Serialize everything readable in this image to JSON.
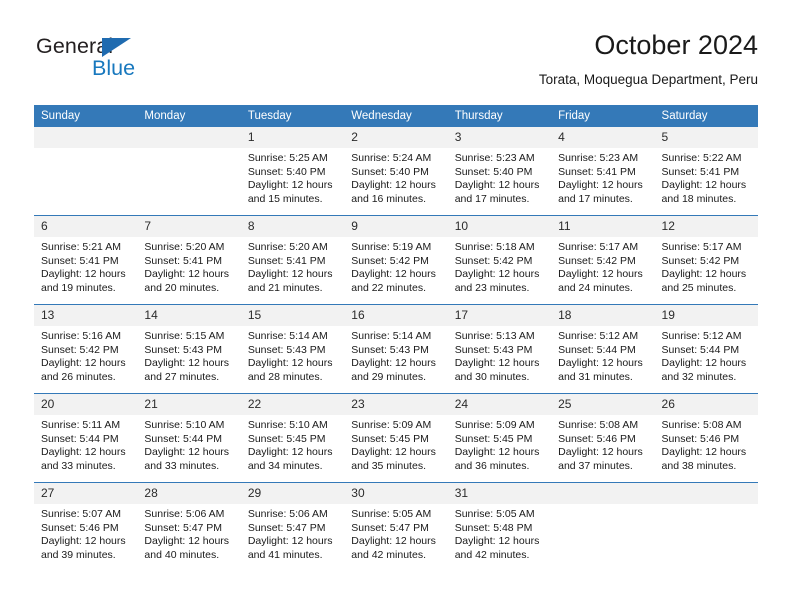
{
  "logo": {
    "word_top": "General",
    "word_bottom": "Blue",
    "triangle_color": "#1f6bb0",
    "blue_color": "#1878be"
  },
  "header": {
    "title": "October 2024",
    "subtitle": "Torata, Moquegua Department, Peru"
  },
  "theme": {
    "header_bg": "#3479b8",
    "header_text": "#ffffff",
    "daynum_bg": "#f2f2f2",
    "row_divider": "#3479b8"
  },
  "weekdays": [
    "Sunday",
    "Monday",
    "Tuesday",
    "Wednesday",
    "Thursday",
    "Friday",
    "Saturday"
  ],
  "labels": {
    "sunrise_prefix": "Sunrise:",
    "sunset_prefix": "Sunset:",
    "daylight_prefix": "Daylight:"
  },
  "weeks": [
    [
      {
        "day": "",
        "sunrise": "",
        "sunset": "",
        "daylight_1": "",
        "daylight_2": ""
      },
      {
        "day": "",
        "sunrise": "",
        "sunset": "",
        "daylight_1": "",
        "daylight_2": ""
      },
      {
        "day": "1",
        "sunrise": "Sunrise: 5:25 AM",
        "sunset": "Sunset: 5:40 PM",
        "daylight_1": "Daylight: 12 hours",
        "daylight_2": "and 15 minutes."
      },
      {
        "day": "2",
        "sunrise": "Sunrise: 5:24 AM",
        "sunset": "Sunset: 5:40 PM",
        "daylight_1": "Daylight: 12 hours",
        "daylight_2": "and 16 minutes."
      },
      {
        "day": "3",
        "sunrise": "Sunrise: 5:23 AM",
        "sunset": "Sunset: 5:40 PM",
        "daylight_1": "Daylight: 12 hours",
        "daylight_2": "and 17 minutes."
      },
      {
        "day": "4",
        "sunrise": "Sunrise: 5:23 AM",
        "sunset": "Sunset: 5:41 PM",
        "daylight_1": "Daylight: 12 hours",
        "daylight_2": "and 17 minutes."
      },
      {
        "day": "5",
        "sunrise": "Sunrise: 5:22 AM",
        "sunset": "Sunset: 5:41 PM",
        "daylight_1": "Daylight: 12 hours",
        "daylight_2": "and 18 minutes."
      }
    ],
    [
      {
        "day": "6",
        "sunrise": "Sunrise: 5:21 AM",
        "sunset": "Sunset: 5:41 PM",
        "daylight_1": "Daylight: 12 hours",
        "daylight_2": "and 19 minutes."
      },
      {
        "day": "7",
        "sunrise": "Sunrise: 5:20 AM",
        "sunset": "Sunset: 5:41 PM",
        "daylight_1": "Daylight: 12 hours",
        "daylight_2": "and 20 minutes."
      },
      {
        "day": "8",
        "sunrise": "Sunrise: 5:20 AM",
        "sunset": "Sunset: 5:41 PM",
        "daylight_1": "Daylight: 12 hours",
        "daylight_2": "and 21 minutes."
      },
      {
        "day": "9",
        "sunrise": "Sunrise: 5:19 AM",
        "sunset": "Sunset: 5:42 PM",
        "daylight_1": "Daylight: 12 hours",
        "daylight_2": "and 22 minutes."
      },
      {
        "day": "10",
        "sunrise": "Sunrise: 5:18 AM",
        "sunset": "Sunset: 5:42 PM",
        "daylight_1": "Daylight: 12 hours",
        "daylight_2": "and 23 minutes."
      },
      {
        "day": "11",
        "sunrise": "Sunrise: 5:17 AM",
        "sunset": "Sunset: 5:42 PM",
        "daylight_1": "Daylight: 12 hours",
        "daylight_2": "and 24 minutes."
      },
      {
        "day": "12",
        "sunrise": "Sunrise: 5:17 AM",
        "sunset": "Sunset: 5:42 PM",
        "daylight_1": "Daylight: 12 hours",
        "daylight_2": "and 25 minutes."
      }
    ],
    [
      {
        "day": "13",
        "sunrise": "Sunrise: 5:16 AM",
        "sunset": "Sunset: 5:42 PM",
        "daylight_1": "Daylight: 12 hours",
        "daylight_2": "and 26 minutes."
      },
      {
        "day": "14",
        "sunrise": "Sunrise: 5:15 AM",
        "sunset": "Sunset: 5:43 PM",
        "daylight_1": "Daylight: 12 hours",
        "daylight_2": "and 27 minutes."
      },
      {
        "day": "15",
        "sunrise": "Sunrise: 5:14 AM",
        "sunset": "Sunset: 5:43 PM",
        "daylight_1": "Daylight: 12 hours",
        "daylight_2": "and 28 minutes."
      },
      {
        "day": "16",
        "sunrise": "Sunrise: 5:14 AM",
        "sunset": "Sunset: 5:43 PM",
        "daylight_1": "Daylight: 12 hours",
        "daylight_2": "and 29 minutes."
      },
      {
        "day": "17",
        "sunrise": "Sunrise: 5:13 AM",
        "sunset": "Sunset: 5:43 PM",
        "daylight_1": "Daylight: 12 hours",
        "daylight_2": "and 30 minutes."
      },
      {
        "day": "18",
        "sunrise": "Sunrise: 5:12 AM",
        "sunset": "Sunset: 5:44 PM",
        "daylight_1": "Daylight: 12 hours",
        "daylight_2": "and 31 minutes."
      },
      {
        "day": "19",
        "sunrise": "Sunrise: 5:12 AM",
        "sunset": "Sunset: 5:44 PM",
        "daylight_1": "Daylight: 12 hours",
        "daylight_2": "and 32 minutes."
      }
    ],
    [
      {
        "day": "20",
        "sunrise": "Sunrise: 5:11 AM",
        "sunset": "Sunset: 5:44 PM",
        "daylight_1": "Daylight: 12 hours",
        "daylight_2": "and 33 minutes."
      },
      {
        "day": "21",
        "sunrise": "Sunrise: 5:10 AM",
        "sunset": "Sunset: 5:44 PM",
        "daylight_1": "Daylight: 12 hours",
        "daylight_2": "and 33 minutes."
      },
      {
        "day": "22",
        "sunrise": "Sunrise: 5:10 AM",
        "sunset": "Sunset: 5:45 PM",
        "daylight_1": "Daylight: 12 hours",
        "daylight_2": "and 34 minutes."
      },
      {
        "day": "23",
        "sunrise": "Sunrise: 5:09 AM",
        "sunset": "Sunset: 5:45 PM",
        "daylight_1": "Daylight: 12 hours",
        "daylight_2": "and 35 minutes."
      },
      {
        "day": "24",
        "sunrise": "Sunrise: 5:09 AM",
        "sunset": "Sunset: 5:45 PM",
        "daylight_1": "Daylight: 12 hours",
        "daylight_2": "and 36 minutes."
      },
      {
        "day": "25",
        "sunrise": "Sunrise: 5:08 AM",
        "sunset": "Sunset: 5:46 PM",
        "daylight_1": "Daylight: 12 hours",
        "daylight_2": "and 37 minutes."
      },
      {
        "day": "26",
        "sunrise": "Sunrise: 5:08 AM",
        "sunset": "Sunset: 5:46 PM",
        "daylight_1": "Daylight: 12 hours",
        "daylight_2": "and 38 minutes."
      }
    ],
    [
      {
        "day": "27",
        "sunrise": "Sunrise: 5:07 AM",
        "sunset": "Sunset: 5:46 PM",
        "daylight_1": "Daylight: 12 hours",
        "daylight_2": "and 39 minutes."
      },
      {
        "day": "28",
        "sunrise": "Sunrise: 5:06 AM",
        "sunset": "Sunset: 5:47 PM",
        "daylight_1": "Daylight: 12 hours",
        "daylight_2": "and 40 minutes."
      },
      {
        "day": "29",
        "sunrise": "Sunrise: 5:06 AM",
        "sunset": "Sunset: 5:47 PM",
        "daylight_1": "Daylight: 12 hours",
        "daylight_2": "and 41 minutes."
      },
      {
        "day": "30",
        "sunrise": "Sunrise: 5:05 AM",
        "sunset": "Sunset: 5:47 PM",
        "daylight_1": "Daylight: 12 hours",
        "daylight_2": "and 42 minutes."
      },
      {
        "day": "31",
        "sunrise": "Sunrise: 5:05 AM",
        "sunset": "Sunset: 5:48 PM",
        "daylight_1": "Daylight: 12 hours",
        "daylight_2": "and 42 minutes."
      },
      {
        "day": "",
        "sunrise": "",
        "sunset": "",
        "daylight_1": "",
        "daylight_2": ""
      },
      {
        "day": "",
        "sunrise": "",
        "sunset": "",
        "daylight_1": "",
        "daylight_2": ""
      }
    ]
  ]
}
